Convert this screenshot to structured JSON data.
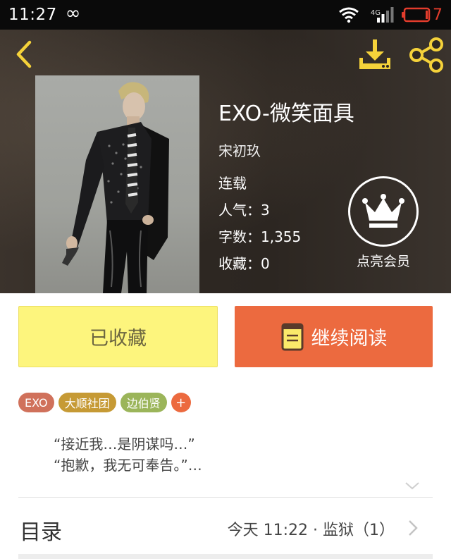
{
  "status_bar": {
    "time": "11:27",
    "infinity_icon": "∞",
    "network": "4G",
    "battery_level": "7"
  },
  "header": {
    "back_icon": "chevron-left-icon",
    "download_icon": "download-icon",
    "share_icon": "share-icon",
    "accent": "#f5d23a"
  },
  "book": {
    "title": "EXO-微笑面具",
    "author": "宋初玖",
    "status": "连载",
    "popularity": "人气：3",
    "word_count": "字数：1,355",
    "favorites": "收藏：0"
  },
  "vip": {
    "label": "点亮会员",
    "icon": "crown-icon"
  },
  "actions": {
    "favorited_label": "已收藏",
    "read_label": "继续阅读",
    "read_icon": "book-icon"
  },
  "tags": [
    "EXO",
    "大顺社团",
    "边伯贤",
    "+"
  ],
  "description": {
    "line1": "“接近我…是阴谋吗…”",
    "line2": "“抱歉，我无可奉告。”…"
  },
  "toc": {
    "title": "目录",
    "latest": "今天 11:22 · 监狱（1）"
  },
  "colors": {
    "favorite_bg": "#fdf57d",
    "read_bg": "#ec6a3f",
    "battery_red": "#e33c2c"
  }
}
